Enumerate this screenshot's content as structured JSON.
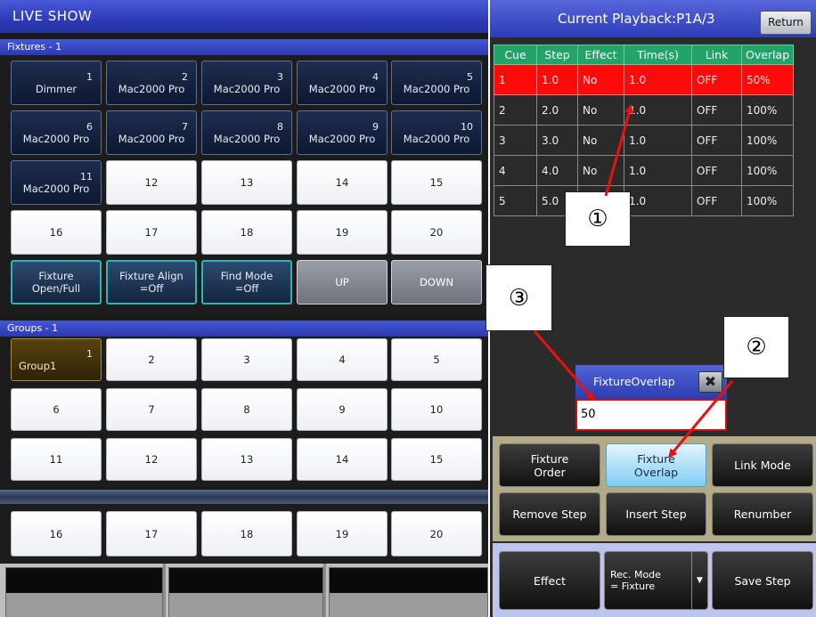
{
  "left": {
    "title": "LIVE SHOW",
    "fixtures_header": "Fixtures - 1",
    "fixtures": [
      {
        "num": "1",
        "name": "Dimmer"
      },
      {
        "num": "2",
        "name": "Mac2000 Pro"
      },
      {
        "num": "3",
        "name": "Mac2000 Pro"
      },
      {
        "num": "4",
        "name": "Mac2000 Pro"
      },
      {
        "num": "5",
        "name": "Mac2000 Pro"
      },
      {
        "num": "6",
        "name": "Mac2000 Pro"
      },
      {
        "num": "7",
        "name": "Mac2000 Pro"
      },
      {
        "num": "8",
        "name": "Mac2000 Pro"
      },
      {
        "num": "9",
        "name": "Mac2000 Pro"
      },
      {
        "num": "10",
        "name": "Mac2000 Pro"
      },
      {
        "num": "11",
        "name": "Mac2000 Pro"
      }
    ],
    "fixture_empty": [
      "12",
      "13",
      "14",
      "15",
      "16",
      "17",
      "18",
      "19",
      "20"
    ],
    "fixture_funcs": [
      {
        "line1": "Fixture",
        "line2": "Open/Full"
      },
      {
        "line1": "Fixture Align",
        "line2": "=Off"
      },
      {
        "line1": "Find Mode",
        "line2": "=Off"
      }
    ],
    "up_label": "UP",
    "down_label": "DOWN",
    "groups_header": "Groups - 1",
    "group1": {
      "num": "1",
      "name": "Group1"
    },
    "group_empty": [
      "2",
      "3",
      "4",
      "5",
      "6",
      "7",
      "8",
      "9",
      "10",
      "11",
      "12",
      "13",
      "14",
      "15"
    ],
    "group_bottom": [
      "16",
      "17",
      "18",
      "19",
      "20"
    ]
  },
  "right": {
    "title": "Current Playback:P1A/3",
    "return_label": "Return",
    "columns": [
      "Cue",
      "Step",
      "Effect",
      "Time(s)",
      "Link",
      "Overlap"
    ],
    "rows": [
      [
        "1",
        "1.0",
        "No",
        "1.0",
        "OFF",
        "50%"
      ],
      [
        "2",
        "2.0",
        "No",
        "1.0",
        "OFF",
        "100%"
      ],
      [
        "3",
        "3.0",
        "No",
        "1.0",
        "OFF",
        "100%"
      ],
      [
        "4",
        "4.0",
        "No",
        "1.0",
        "OFF",
        "100%"
      ],
      [
        "5",
        "5.0",
        "",
        "1.0",
        "OFF",
        "100%"
      ]
    ],
    "popup": {
      "title": "FixtureOverlap",
      "close": "✖",
      "value": "50"
    },
    "buttons": {
      "fixture_order": [
        "Fixture",
        "Order"
      ],
      "fixture_overlap": [
        "Fixture",
        "Overlap"
      ],
      "link_mode": "Link Mode",
      "remove_step": "Remove Step",
      "insert_step": "Insert Step",
      "renumber": "Renumber",
      "effect": "Effect",
      "rec_mode": [
        "Rec. Mode",
        "= Fixture"
      ],
      "save_step": "Save Step"
    }
  },
  "annotations": {
    "a1": "①",
    "a2": "②",
    "a3": "③"
  },
  "colors": {
    "annotation_arrow": "#e81010",
    "selected_row": "#ff0a0a",
    "header_green": "#22a36a"
  }
}
